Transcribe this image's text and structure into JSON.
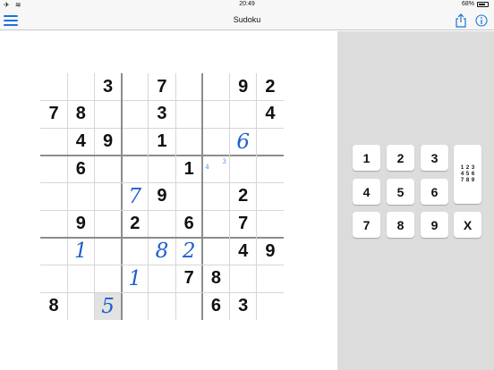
{
  "status_bar": {
    "time": "20:49",
    "battery": "68%"
  },
  "nav": {
    "title": "Sudoku"
  },
  "colors": {
    "accent": "#1a73d9",
    "pencil": "#1d5fcf",
    "panel": "#dcdcdc",
    "thick_line": "#8c8c8c"
  },
  "board": {
    "rows": [
      [
        "",
        "",
        "3",
        "",
        "7",
        "",
        "",
        "9",
        "2"
      ],
      [
        "7",
        "8",
        "",
        "",
        "3",
        "",
        "",
        "",
        "4"
      ],
      [
        "",
        "4",
        "9",
        "",
        "1",
        "",
        "",
        "6",
        ""
      ],
      [
        "",
        "6",
        "",
        "",
        "",
        "1",
        "",
        "",
        ""
      ],
      [
        "",
        "",
        "",
        "7",
        "9",
        "",
        "",
        "2",
        ""
      ],
      [
        "",
        "9",
        "",
        "2",
        "",
        "6",
        "",
        "7",
        ""
      ],
      [
        "",
        "1",
        "",
        "",
        "8",
        "2",
        "",
        "4",
        "9"
      ],
      [
        "",
        "",
        "",
        "1",
        "",
        "7",
        "8",
        "",
        ""
      ],
      [
        "8",
        "",
        "5",
        "",
        "",
        "",
        "6",
        "3",
        ""
      ]
    ],
    "pencil_cells": [
      [
        2,
        7
      ],
      [
        4,
        3
      ],
      [
        6,
        1
      ],
      [
        6,
        4
      ],
      [
        6,
        5
      ],
      [
        7,
        3
      ],
      [
        8,
        2
      ]
    ],
    "selected_cell": [
      8,
      2
    ],
    "notes": [
      {
        "row": 3,
        "col": 6,
        "values": [
          "4",
          "3"
        ]
      }
    ]
  },
  "keypad": {
    "digits": [
      "1",
      "2",
      "3",
      "4",
      "5",
      "6",
      "7",
      "8",
      "9"
    ],
    "clear_label": "X",
    "notes_digits": [
      "1",
      "2",
      "3",
      "4",
      "5",
      "6",
      "7",
      "8",
      "9"
    ]
  }
}
